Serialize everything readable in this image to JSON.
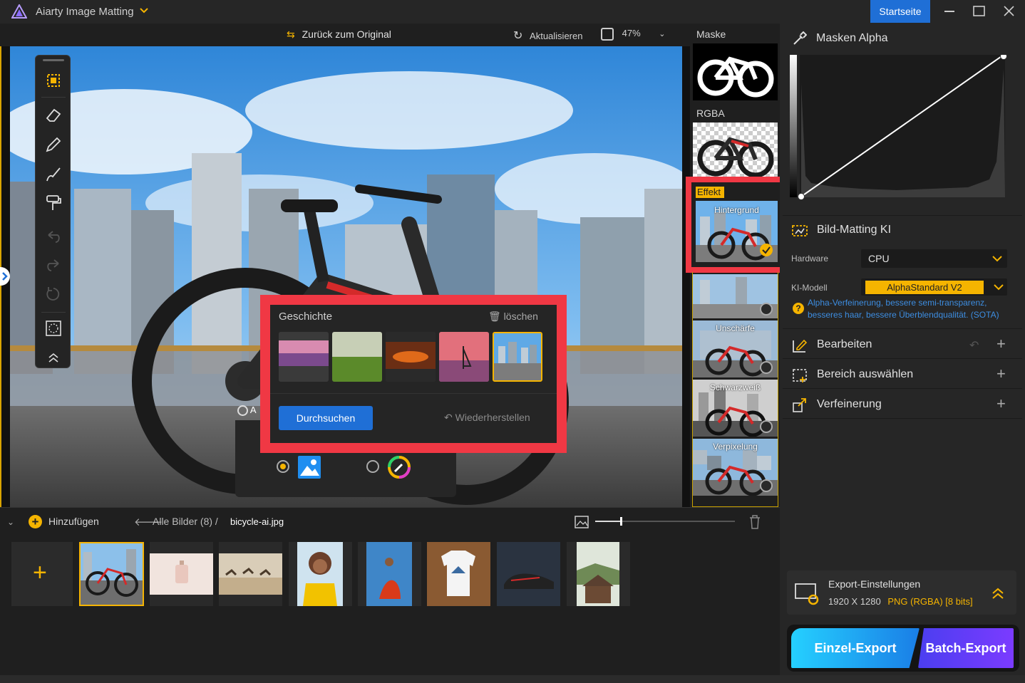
{
  "app": {
    "title": "Aiarty Image Matting",
    "home_button": "Startseite"
  },
  "canvas_toolbar": {
    "back_to_original": "Zurück zum Original",
    "refresh": "Aktualisieren",
    "zoom": "47%"
  },
  "history": {
    "title": "Geschichte",
    "delete": "löschen",
    "browse": "Durchsuchen",
    "restore": "Wiederherstellen",
    "thumbs": [
      "lavender-field",
      "green-field",
      "sunset-clouds",
      "sailboat-sunset",
      "city-skyline"
    ]
  },
  "canvas_overlay_partial": "A",
  "preview_column": {
    "mask_label": "Maske",
    "rgba_label": "RGBA",
    "effect_label": "Effekt",
    "effects": [
      {
        "label": "Hintergrund"
      },
      {
        "label": ""
      },
      {
        "label": "Unschärfe"
      },
      {
        "label": "Schwarzweiß"
      },
      {
        "label": "Verpixelung"
      }
    ]
  },
  "right_panel": {
    "alpha_title": "Masken Alpha",
    "matting_title": "Bild-Matting KI",
    "hardware_label": "Hardware",
    "hardware_value": "CPU",
    "model_label": "KI-Modell",
    "model_value": "AlphaStandard  V2",
    "model_description": "Alpha-Verfeinerung, bessere semi-transparenz, besseres haar, bessere Überblendqualität. (SOTA)",
    "sections": [
      "Bearbeiten",
      "Bereich auswählen",
      "Verfeinerung"
    ],
    "export_title": "Export-Einstellungen",
    "export_resolution": "1920 X 1280",
    "export_format": "PNG (RGBA) [8 bits]",
    "single_export": "Einzel-Export",
    "batch_export": "Batch-Export"
  },
  "bottom_bar": {
    "add": "Hinzufügen",
    "all_images": "Alle Bilder (8)  /",
    "file_name": "bicycle-ai.jpg"
  },
  "gallery": [
    "bicycle-ai",
    "perfume",
    "camels-desert",
    "woman-yellow",
    "dancer-red",
    "tshirt",
    "sneaker",
    "wood-cabin"
  ],
  "colors": {
    "accent_yellow": "#f5b400",
    "accent_blue": "#1f6fd6",
    "highlight_red": "#f03844"
  }
}
